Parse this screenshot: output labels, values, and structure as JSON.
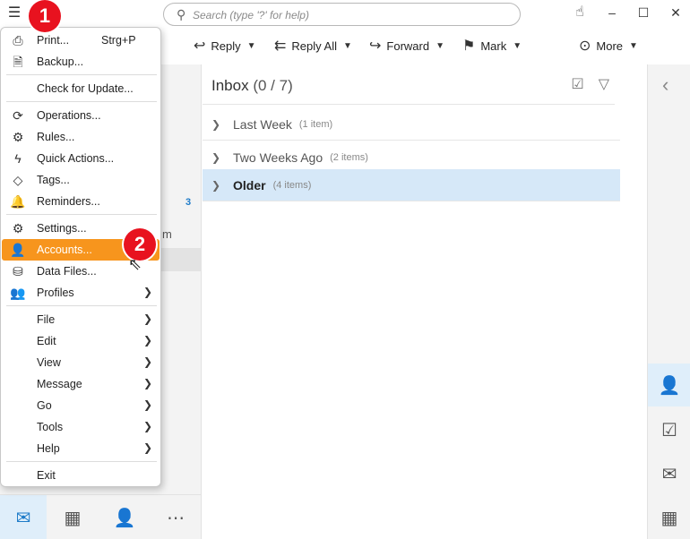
{
  "titlebar": {
    "menu_icon": "hamburger-icon",
    "search_placeholder": "Search (type '?' for help)",
    "touch_icon": "hand-touch-icon",
    "minimize": "–",
    "maximize": "☐",
    "close": "✕"
  },
  "toolbar": {
    "reply": "Reply",
    "reply_all": "Reply All",
    "forward": "Forward",
    "mark": "Mark",
    "more": "More"
  },
  "leftpane": {
    "count": "3",
    "fragment": "m"
  },
  "msglist": {
    "title": "Inbox",
    "count": "(0 / 7)",
    "groups": [
      {
        "name": "Last Week",
        "count": "(1 item)"
      },
      {
        "name": "Two Weeks Ago",
        "count": "(2 items)"
      },
      {
        "name": "Older",
        "count": "(4 items)"
      }
    ]
  },
  "menu": {
    "items": [
      {
        "label": "Print...",
        "shortcut": "Strg+P",
        "icon": "printer-icon"
      },
      {
        "label": "Backup...",
        "icon": "backup-icon"
      },
      {
        "label": "Check for Update..."
      },
      {
        "label": "Operations...",
        "icon": "sync-icon"
      },
      {
        "label": "Rules...",
        "icon": "rules-icon"
      },
      {
        "label": "Quick Actions...",
        "icon": "lightning-icon"
      },
      {
        "label": "Tags...",
        "icon": "tag-icon"
      },
      {
        "label": "Reminders...",
        "icon": "bell-icon"
      },
      {
        "label": "Settings...",
        "icon": "gear-icon"
      },
      {
        "label": "Accounts...",
        "icon": "account-icon"
      },
      {
        "label": "Data Files...",
        "icon": "database-icon"
      },
      {
        "label": "Profiles",
        "icon": "profiles-icon"
      },
      {
        "label": "File"
      },
      {
        "label": "Edit"
      },
      {
        "label": "View"
      },
      {
        "label": "Message"
      },
      {
        "label": "Go"
      },
      {
        "label": "Tools"
      },
      {
        "label": "Help"
      },
      {
        "label": "Exit"
      }
    ]
  },
  "annotations": {
    "step1": "1",
    "step2": "2"
  },
  "colors": {
    "highlight": "#f7951d",
    "badge": "#e8121f",
    "accent": "#1e7bc8",
    "selection": "#d6e8f8"
  }
}
